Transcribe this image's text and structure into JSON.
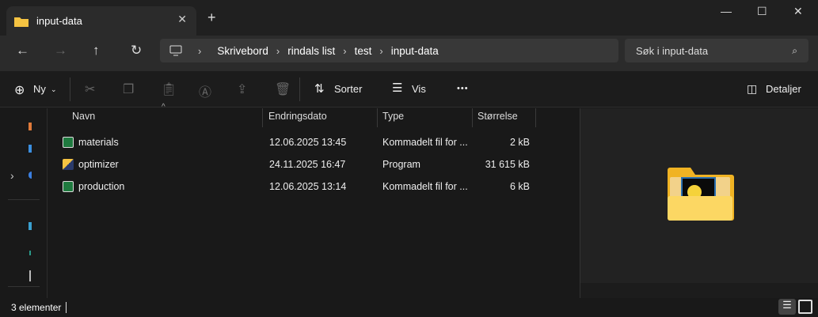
{
  "window": {
    "tab_title": "input-data",
    "new_tab": "+",
    "close_tab": "✕",
    "minimize": "—",
    "maximize": "☐",
    "close": "✕"
  },
  "nav": {
    "back": "←",
    "forward": "→",
    "up": "↑",
    "refresh": "↻",
    "breadcrumb": [
      "Skrivebord",
      "rindals list",
      "test",
      "input-data"
    ],
    "search_placeholder": "Søk i input-data"
  },
  "toolbar": {
    "new_label": "Ny",
    "sort_label": "Sorter",
    "view_label": "Vis",
    "more": "•••",
    "details_label": "Detaljer"
  },
  "columns": [
    "Navn",
    "Endringsdato",
    "Type",
    "Størrelse"
  ],
  "files": [
    {
      "name": "materials",
      "date": "12.06.2025 13:45",
      "type": "Kommadelt fil for ...",
      "size": "2 kB",
      "icon": "excel-csv-icon"
    },
    {
      "name": "optimizer",
      "date": "24.11.2025 16:47",
      "type": "Program",
      "size": "31 615 kB",
      "icon": "python-exe-icon"
    },
    {
      "name": "production",
      "date": "12.06.2025 13:14",
      "type": "Kommadelt fil for ...",
      "size": "6 kB",
      "icon": "excel-csv-icon"
    }
  ],
  "status": {
    "count": "3 elementer"
  },
  "colors": {
    "folder": "#f5c342",
    "excel": "#1f7a3f"
  }
}
